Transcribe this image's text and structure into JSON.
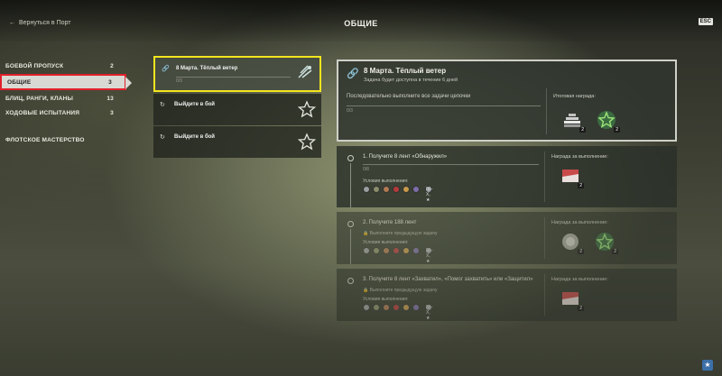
{
  "header": {
    "back_label": "Вернуться в Порт",
    "title": "ОБЩИЕ",
    "lang_badge": "ESC"
  },
  "sidebar": {
    "items": [
      {
        "label": "БОЕВОЙ ПРОПУСК",
        "count": "2"
      },
      {
        "label": "ОБЩИЕ",
        "count": "3"
      },
      {
        "label": "БЛИЦ, РАНГИ, КЛАНЫ",
        "count": "13"
      },
      {
        "label": "ХОДОВЫЕ ИСПЫТАНИЯ",
        "count": "3"
      }
    ],
    "extra": "ФЛОТСКОЕ МАСТЕРСТВО"
  },
  "missions": [
    {
      "label": "8 Марта. Тёплый ветер",
      "progress": "0/3"
    },
    {
      "label": "Выйдите в бой"
    },
    {
      "label": "Выйдите в бой"
    }
  ],
  "detail": {
    "title": "8 Марта. Тёплый ветер",
    "subtitle": "Задача будет доступна в течение 6 дней",
    "desc": "Последовательно выполните все задачи цепочки",
    "progress": "0/3",
    "reward_label": "Итоговая награда:",
    "reward_count_1": "2",
    "reward_count_2": "2"
  },
  "tasks": [
    {
      "title": "1. Получите 8 лент «Обнаружил»",
      "progress": "0/8",
      "cond": "Условия выполнения:",
      "tier": "IV–X, ★",
      "reward_label": "Награда за выполнение:",
      "r1": "2"
    },
    {
      "title": "2. Получите 188 лент",
      "locked": "Выполните предыдущую задачу",
      "cond": "Условия выполнения:",
      "tier": "IV–X, ★",
      "reward_label": "Награда за выполнение:",
      "r1": "2",
      "r2": "2"
    },
    {
      "title": "3. Получите 8 лент «Захватил», «Помог захватить» или «Защитил»",
      "locked": "Выполните предыдущую задачу",
      "cond": "Условия выполнения:",
      "tier": "IV–X, ★",
      "reward_label": "Награда за выполнение:",
      "r1": "2"
    }
  ],
  "colors": {
    "accent": "#f3e51d",
    "active_border": "#e0202a"
  }
}
